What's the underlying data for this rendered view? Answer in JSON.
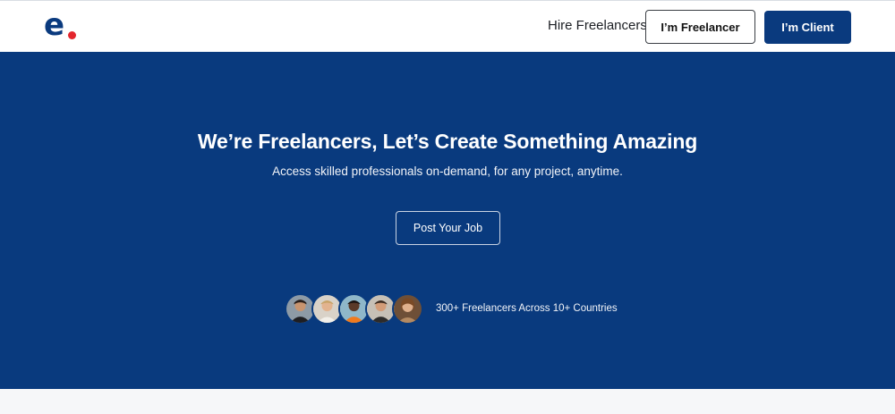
{
  "header": {
    "logo": {
      "glyph": "e",
      "icon": "brand-logo-icon",
      "colors": {
        "letter": "#0a3a7e",
        "dot": "#e3262d"
      }
    },
    "nav_link": "Hire Freelancers",
    "freelancer_button": "I’m Freelancer",
    "client_button": "I’m Client"
  },
  "hero": {
    "title": "We’re Freelancers, Let’s Create Something Amazing",
    "subtitle": "Access skilled professionals on-demand, for any project, anytime.",
    "cta": "Post Your Job",
    "social_proof": "300+ Freelancers Across 10+ Countries",
    "avatars": [
      {
        "icon": "freelancer-avatar-1"
      },
      {
        "icon": "freelancer-avatar-2"
      },
      {
        "icon": "freelancer-avatar-3"
      },
      {
        "icon": "freelancer-avatar-4"
      },
      {
        "icon": "freelancer-avatar-5"
      }
    ]
  },
  "colors": {
    "brand": "#0a3a7e",
    "accent": "#e3262d",
    "hero_bg": "#093a7e"
  }
}
